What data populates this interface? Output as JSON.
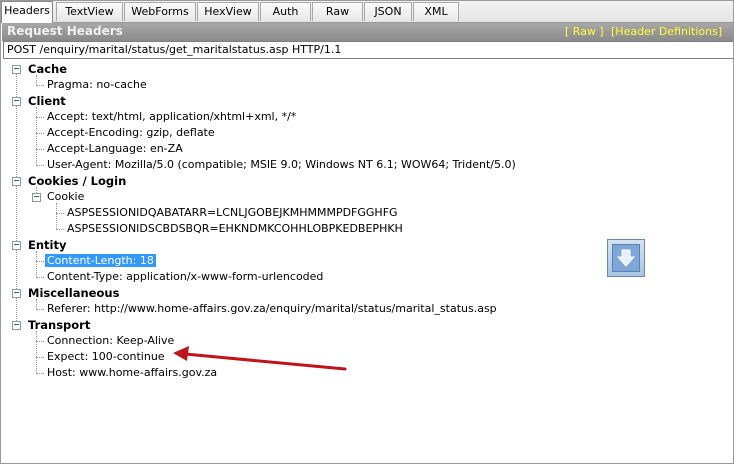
{
  "tabs": [
    {
      "label": "Headers"
    },
    {
      "label": "TextView"
    },
    {
      "label": "WebForms"
    },
    {
      "label": "HexView"
    },
    {
      "label": "Auth"
    },
    {
      "label": "Raw"
    },
    {
      "label": "JSON"
    },
    {
      "label": "XML"
    }
  ],
  "header": {
    "title": "Request Headers",
    "raw_link": "[ Raw ]",
    "definitions_link": "[Header Definitions]"
  },
  "request_line": "POST /enquiry/marital/status/get_maritalstatus.asp HTTP/1.1",
  "groups": {
    "cache": {
      "label": "Cache",
      "items": [
        "Pragma: no-cache"
      ]
    },
    "client": {
      "label": "Client",
      "items": [
        "Accept: text/html, application/xhtml+xml, */*",
        "Accept-Encoding: gzip, deflate",
        "Accept-Language: en-ZA",
        "User-Agent: Mozilla/5.0 (compatible; MSIE 9.0; Windows NT 6.1; WOW64; Trident/5.0)"
      ]
    },
    "cookies": {
      "label": "Cookies / Login",
      "cookie_label": "Cookie",
      "cookie_items": [
        "ASPSESSIONIDQABATARR=LCNLJGOBEJKMHMMMPDFGGHFG",
        "ASPSESSIONIDSCBDSBQR=EHKNDMKCOHHLOBPKEDBEPHKH"
      ]
    },
    "entity": {
      "label": "Entity",
      "items": [
        "Content-Length: 18",
        "Content-Type: application/x-www-form-urlencoded"
      ],
      "selected_index": 0
    },
    "misc": {
      "label": "Miscellaneous",
      "items": [
        "Referer: http://www.home-affairs.gov.za/enquiry/marital/status/marital_status.asp"
      ]
    },
    "transport": {
      "label": "Transport",
      "items": [
        "Connection: Keep-Alive",
        "Expect: 100-continue",
        "Host: www.home-affairs.gov.za"
      ]
    }
  },
  "colors": {
    "selection": "#3399ff",
    "header_link": "#ffff33",
    "arrow": "#c0141c"
  }
}
